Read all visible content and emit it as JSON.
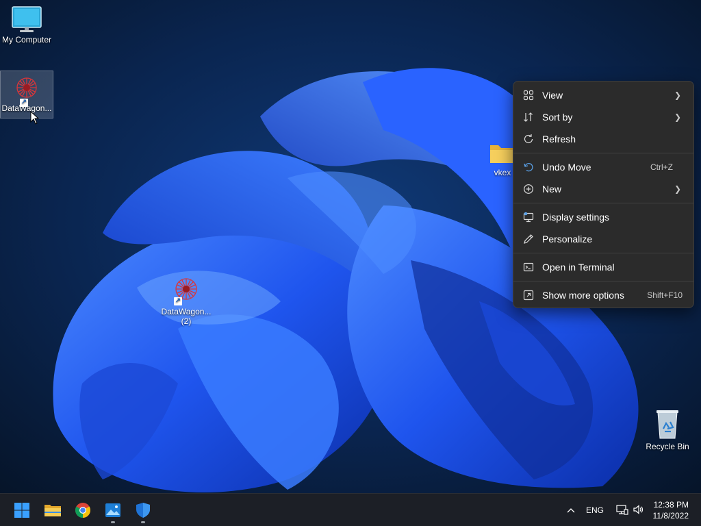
{
  "desktop": {
    "icons": [
      {
        "label": "My Computer",
        "icon": "monitor-icon"
      },
      {
        "label": "DataWagon...",
        "icon": "datawagon-app-icon"
      },
      {
        "label": "DataWagon...\n(2)",
        "icon": "datawagon-app-icon"
      },
      {
        "label": "vkex",
        "icon": "folder-icon"
      },
      {
        "label": "Recycle Bin",
        "icon": "recycle-bin-icon"
      }
    ]
  },
  "context_menu": {
    "items": [
      {
        "label": "View",
        "icon": "view-grid-icon",
        "shortcut": "",
        "has_submenu": true
      },
      {
        "label": "Sort by",
        "icon": "sort-icon",
        "shortcut": "",
        "has_submenu": true
      },
      {
        "label": "Refresh",
        "icon": "refresh-icon",
        "shortcut": "",
        "has_submenu": false
      },
      {
        "label": "Undo Move",
        "icon": "undo-icon",
        "shortcut": "Ctrl+Z",
        "has_submenu": false
      },
      {
        "label": "New",
        "icon": "new-plus-icon",
        "shortcut": "",
        "has_submenu": true
      },
      {
        "label": "Display settings",
        "icon": "display-settings-icon",
        "shortcut": "",
        "has_submenu": false
      },
      {
        "label": "Personalize",
        "icon": "pen-icon",
        "shortcut": "",
        "has_submenu": false
      },
      {
        "label": "Open in Terminal",
        "icon": "terminal-icon",
        "shortcut": "",
        "has_submenu": false
      },
      {
        "label": "Show more options",
        "icon": "more-options-icon",
        "shortcut": "Shift+F10",
        "has_submenu": false
      }
    ]
  },
  "taskbar": {
    "apps": [
      {
        "name": "Start",
        "icon": "windows-start-icon",
        "running": false
      },
      {
        "name": "File Explorer",
        "icon": "file-explorer-icon",
        "running": false
      },
      {
        "name": "Chrome",
        "icon": "chrome-icon",
        "running": false
      },
      {
        "name": "Photos",
        "icon": "photos-icon",
        "running": true
      },
      {
        "name": "Windows Security",
        "icon": "security-shield-icon",
        "running": true
      }
    ],
    "tray": {
      "language": "ENG",
      "time": "12:38 PM",
      "date": "11/8/2022"
    }
  },
  "colors": {
    "accent": "#2f6bff",
    "menu_bg": "#2b2b2b",
    "taskbar_bg": "#1c1f26"
  }
}
